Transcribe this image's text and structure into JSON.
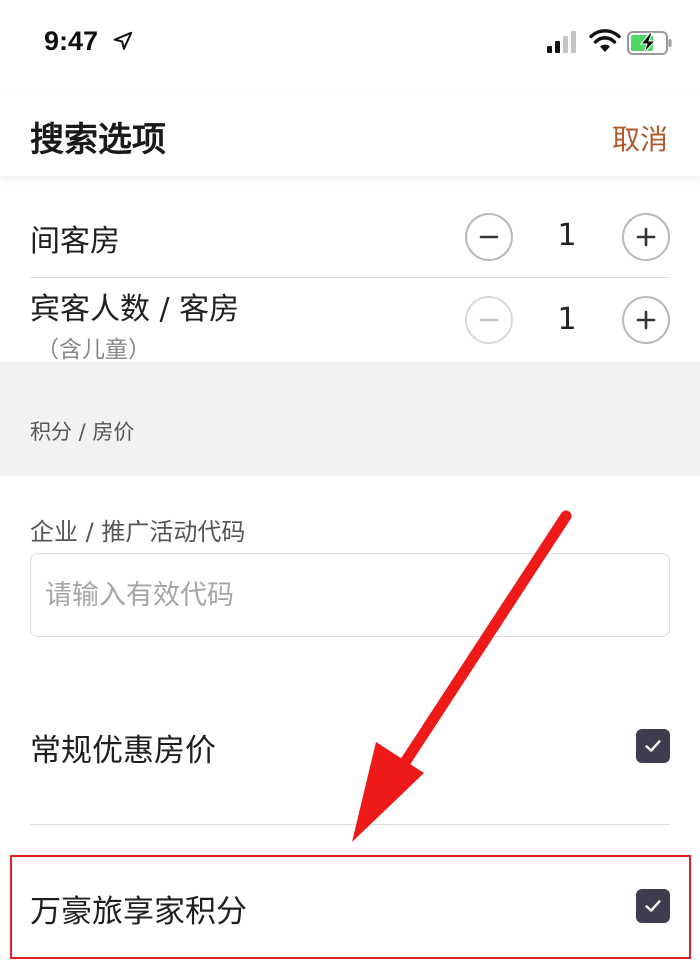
{
  "status_bar": {
    "time": "9:47",
    "icons": [
      "location-arrow-icon",
      "cellular-signal-icon",
      "wifi-icon",
      "battery-charging-icon"
    ]
  },
  "header": {
    "title": "搜索选项",
    "cancel_label": "取消"
  },
  "rooms": {
    "label": "间客房",
    "value": "1"
  },
  "guests": {
    "label": "宾客人数 / 客房",
    "sub_label": "（含儿童）",
    "value": "1",
    "decrement_disabled": true
  },
  "points_section": {
    "title": "积分 / 房价"
  },
  "promo_code": {
    "label": "企业 / 推广活动代码",
    "placeholder": "请输入有效代码",
    "value": ""
  },
  "options": [
    {
      "label": "常规优惠房价",
      "checked": true
    },
    {
      "label": "万豪旅享家积分",
      "checked": true
    }
  ],
  "annotation": {
    "color": "#e02020"
  },
  "colors": {
    "accent": "#b05a2c",
    "checkbox": "#3d3d4f",
    "section_bg": "#f2f2f2"
  }
}
